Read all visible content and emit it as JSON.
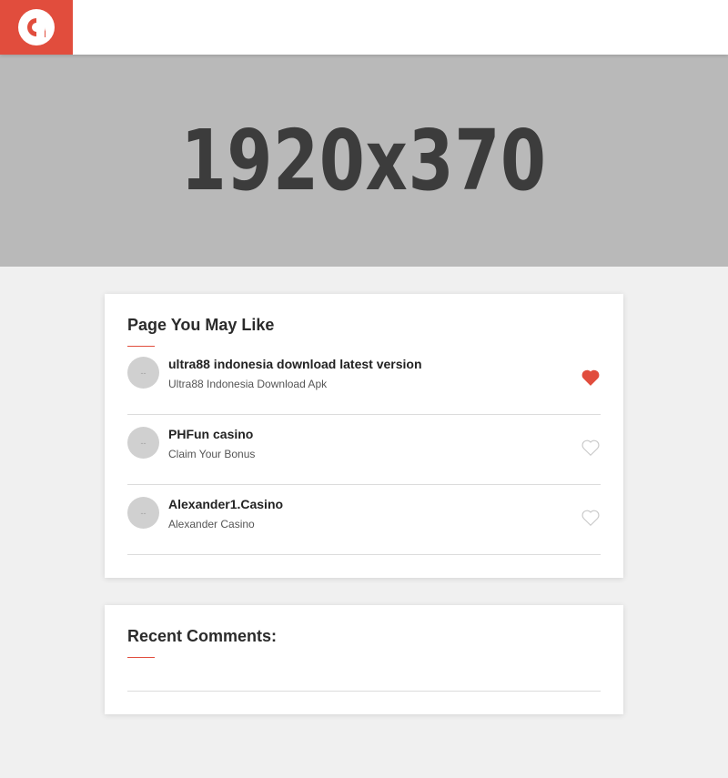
{
  "header": {
    "logo_icon": "app-logo-icon",
    "brand_color": "#e14d3d"
  },
  "banner": {
    "text": "1920x370"
  },
  "pages_widget": {
    "title": "Page You May Like",
    "items": [
      {
        "name": "ultra88 indonesia download latest version",
        "subtitle": "Ultra88 Indonesia Download Apk",
        "avatar_text": "--",
        "liked": true
      },
      {
        "name": "PHFun casino",
        "subtitle": "Claim Your Bonus",
        "avatar_text": "--",
        "liked": false
      },
      {
        "name": "Alexander1.Casino",
        "subtitle": "Alexander Casino",
        "avatar_text": "--",
        "liked": false
      }
    ]
  },
  "comments_widget": {
    "title": "Recent Comments:"
  }
}
